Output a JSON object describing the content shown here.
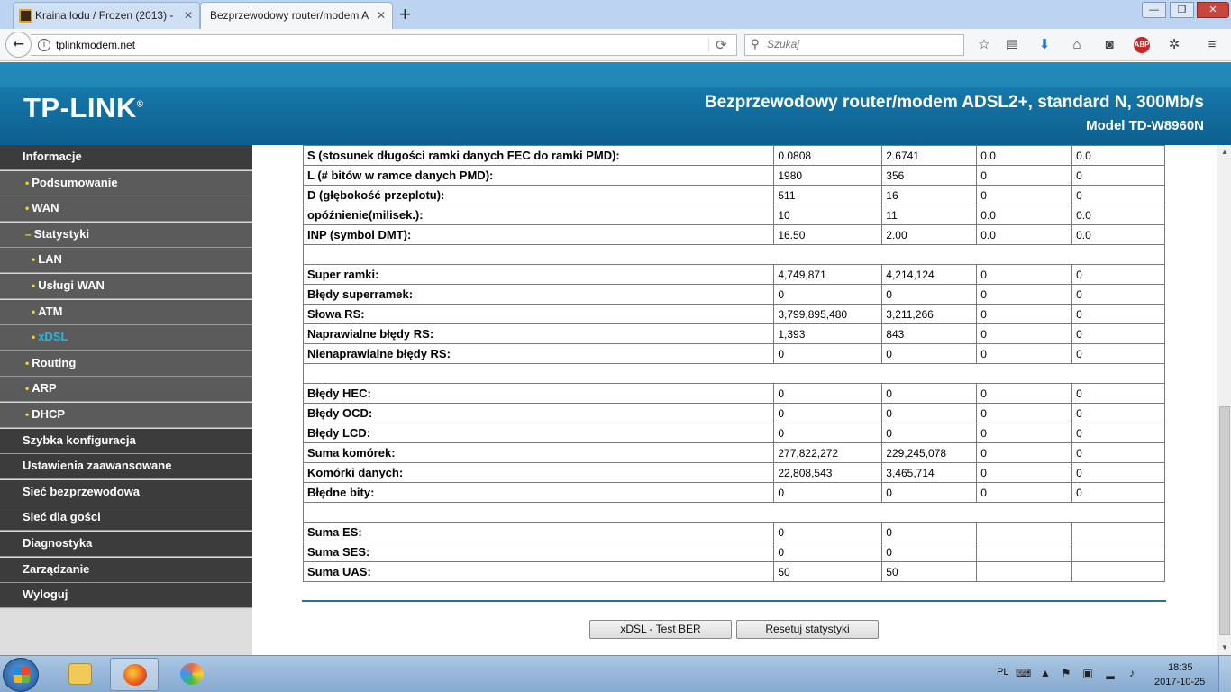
{
  "browser": {
    "tabs": [
      {
        "title": "Kraina lodu / Frozen (2013) -",
        "active": false
      },
      {
        "title": "Bezprzewodowy router/modem A",
        "active": true
      }
    ],
    "new_tab": "+",
    "url": "tplinkmodem.net",
    "search_placeholder": "Szukaj",
    "abp_label": "ABP",
    "window_buttons": {
      "minimize": "—",
      "maximize": "❐",
      "close": "✕"
    }
  },
  "header": {
    "logo": "TP-LINK",
    "logo_mark": "®",
    "title": "Bezprzewodowy router/modem ADSL2+, standard N, 300Mb/s",
    "model": "Model TD-W8960N",
    "colors": {
      "header_blue": "#1576a8",
      "active_menu": "#21b9e8",
      "bullet": "#f2d23a"
    }
  },
  "sidebar": {
    "items": [
      {
        "label": "Informacje",
        "level": 0,
        "bullet": "",
        "active": false
      },
      {
        "label": "Podsumowanie",
        "level": 1,
        "bullet": "•",
        "active": false
      },
      {
        "label": "WAN",
        "level": 1,
        "bullet": "•",
        "active": false
      },
      {
        "label": "Statystyki",
        "level": 1,
        "bullet": "–",
        "active": false
      },
      {
        "label": "LAN",
        "level": 2,
        "bullet": "•",
        "active": false
      },
      {
        "label": "Usługi WAN",
        "level": 2,
        "bullet": "•",
        "active": false
      },
      {
        "label": "ATM",
        "level": 2,
        "bullet": "•",
        "active": false
      },
      {
        "label": "xDSL",
        "level": 2,
        "bullet": "•",
        "active": true
      },
      {
        "label": "Routing",
        "level": 1,
        "bullet": "•",
        "active": false
      },
      {
        "label": "ARP",
        "level": 1,
        "bullet": "•",
        "active": false
      },
      {
        "label": "DHCP",
        "level": 1,
        "bullet": "•",
        "active": false
      },
      {
        "label": "Szybka konfiguracja",
        "level": 0,
        "bullet": "",
        "active": false
      },
      {
        "label": "Ustawienia zaawansowane",
        "level": 0,
        "bullet": "",
        "active": false
      },
      {
        "label": "Sieć bezprzewodowa",
        "level": 0,
        "bullet": "",
        "active": false
      },
      {
        "label": "Sieć dla gości",
        "level": 0,
        "bullet": "",
        "active": false
      },
      {
        "label": "Diagnostyka",
        "level": 0,
        "bullet": "",
        "active": false
      },
      {
        "label": "Zarządzanie",
        "level": 0,
        "bullet": "",
        "active": false
      },
      {
        "label": "Wyloguj",
        "level": 0,
        "bullet": "",
        "active": false
      }
    ]
  },
  "stats": {
    "rows": [
      {
        "label": "S (stosunek długości ramki danych FEC do ramki PMD):",
        "values": [
          "0.0808",
          "2.6741",
          "0.0",
          "0.0"
        ]
      },
      {
        "label": "L (# bitów w ramce danych PMD):",
        "values": [
          "1980",
          "356",
          "0",
          "0"
        ]
      },
      {
        "label": "D (głębokość przeplotu):",
        "values": [
          "511",
          "16",
          "0",
          "0"
        ]
      },
      {
        "label": "opóźnienie(milisek.):",
        "values": [
          "10",
          "11",
          "0.0",
          "0.0"
        ]
      },
      {
        "label": "INP (symbol DMT):",
        "values": [
          "16.50",
          "2.00",
          "0.0",
          "0.0"
        ]
      },
      {
        "blank": true
      },
      {
        "label": "Super ramki:",
        "values": [
          "4,749,871",
          "4,214,124",
          "0",
          "0"
        ]
      },
      {
        "label": "Błędy superramek:",
        "values": [
          "0",
          "0",
          "0",
          "0"
        ]
      },
      {
        "label": "Słowa RS:",
        "values": [
          "3,799,895,480",
          "3,211,266",
          "0",
          "0"
        ]
      },
      {
        "label": "Naprawialne błędy RS:",
        "values": [
          "1,393",
          "843",
          "0",
          "0"
        ]
      },
      {
        "label": "Nienaprawialne błędy RS:",
        "values": [
          "0",
          "0",
          "0",
          "0"
        ]
      },
      {
        "blank": true
      },
      {
        "label": "Błędy HEC:",
        "values": [
          "0",
          "0",
          "0",
          "0"
        ]
      },
      {
        "label": "Błędy OCD:",
        "values": [
          "0",
          "0",
          "0",
          "0"
        ]
      },
      {
        "label": "Błędy LCD:",
        "values": [
          "0",
          "0",
          "0",
          "0"
        ]
      },
      {
        "label": "Suma komórek:",
        "values": [
          "277,822,272",
          "229,245,078",
          "0",
          "0"
        ]
      },
      {
        "label": "Komórki danych:",
        "values": [
          "22,808,543",
          "3,465,714",
          "0",
          "0"
        ]
      },
      {
        "label": "Błędne bity:",
        "values": [
          "0",
          "0",
          "0",
          "0"
        ]
      },
      {
        "blank": true
      },
      {
        "label": "Suma ES:",
        "values": [
          "0",
          "0",
          "",
          ""
        ]
      },
      {
        "label": "Suma SES:",
        "values": [
          "0",
          "0",
          "",
          ""
        ]
      },
      {
        "label": "Suma UAS:",
        "values": [
          "50",
          "50",
          "",
          ""
        ]
      }
    ]
  },
  "buttons": {
    "ber_test": "xDSL - Test BER",
    "reset_stats": "Resetuj statystyki"
  },
  "taskbar": {
    "language": "PL",
    "time": "18:35",
    "date": "2017-10-25"
  }
}
